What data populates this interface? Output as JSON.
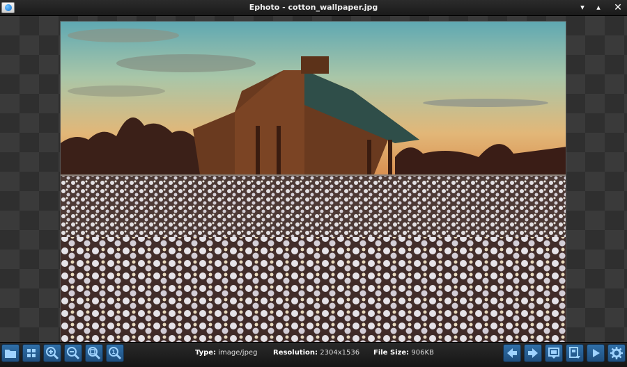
{
  "window": {
    "title": "Ephoto - cotton_wallpaper.jpg"
  },
  "window_controls": [
    "chevron-down-icon",
    "chevron-up-icon",
    "close-icon"
  ],
  "image": {
    "description_icon": "photo",
    "scene": "barn-cotton-field"
  },
  "status": {
    "type_label": "Type:",
    "type_value": "image/jpeg",
    "resolution_label": "Resolution:",
    "resolution_value": "2304x1536",
    "size_label": "File Size:",
    "size_value": "906KB"
  },
  "toolbar": {
    "left_buttons": [
      "folder-icon",
      "grid-icon",
      "zoom-in-icon",
      "zoom-out-icon",
      "zoom-fit-icon",
      "zoom-actual-icon"
    ],
    "right_buttons": [
      "previous-icon",
      "next-icon",
      "slideshow-icon",
      "save-icon",
      "play-icon",
      "settings-icon"
    ]
  },
  "colors": {
    "accent": "#2f6fa8",
    "icon": "#9fd3ff"
  }
}
